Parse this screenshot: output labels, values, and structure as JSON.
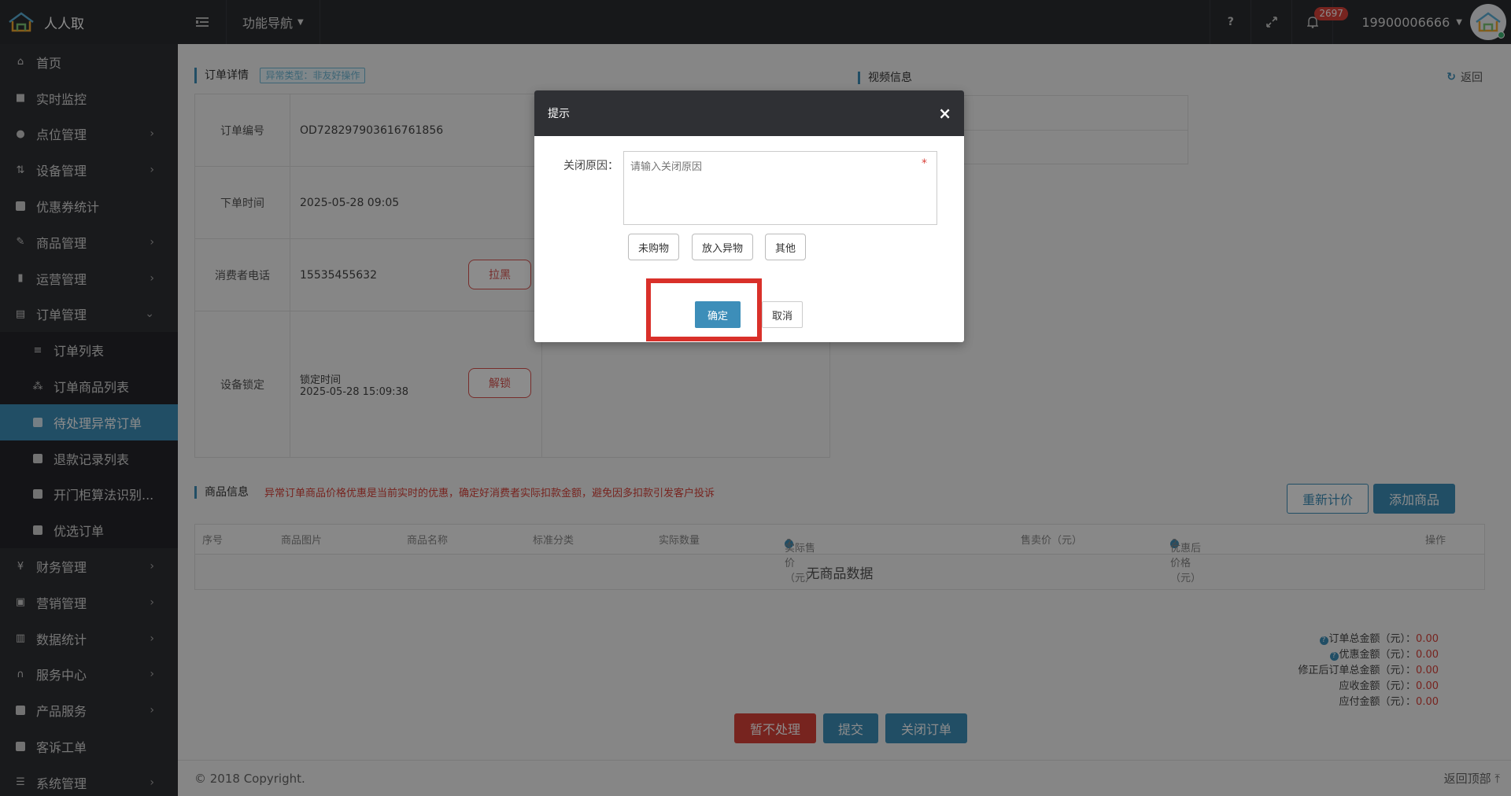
{
  "brand": {
    "name": "人人取"
  },
  "topbar": {
    "nav_label": "功能导航",
    "help": "?",
    "notification_count": "2697",
    "user_name": "19900006666"
  },
  "sidebar": {
    "items": [
      {
        "label": "首页",
        "icon": "home-icon"
      },
      {
        "label": "实时监控",
        "icon": "video-camera-icon"
      },
      {
        "label": "点位管理",
        "icon": "map-marker-icon",
        "arrow": "›"
      },
      {
        "label": "设备管理",
        "icon": "sort-icon",
        "arrow": "›"
      },
      {
        "label": "优惠券统计",
        "icon": "square-icon"
      },
      {
        "label": "商品管理",
        "icon": "edit-icon",
        "arrow": "›"
      },
      {
        "label": "运营管理",
        "icon": "bookmark-icon",
        "arrow": "›"
      },
      {
        "label": "订单管理",
        "icon": "list-alt-icon",
        "arrow": "⌄"
      }
    ],
    "sub_items": [
      {
        "label": "订单列表",
        "icon": "bars-icon"
      },
      {
        "label": "订单商品列表",
        "icon": "sitemap-icon"
      },
      {
        "label": "待处理异常订单",
        "icon": "square-icon",
        "active": true
      },
      {
        "label": "退款记录列表",
        "icon": "square-icon"
      },
      {
        "label": "开门柜算法识别...",
        "icon": "square-icon"
      },
      {
        "label": "优选订单",
        "icon": "square-icon"
      }
    ],
    "items_after": [
      {
        "label": "财务管理",
        "icon": "yen-icon",
        "arrow": "›"
      },
      {
        "label": "营销管理",
        "icon": "gift-icon",
        "arrow": "›"
      },
      {
        "label": "数据统计",
        "icon": "bar-chart-icon",
        "arrow": "›"
      },
      {
        "label": "服务中心",
        "icon": "headphones-icon",
        "arrow": "›"
      },
      {
        "label": "产品服务",
        "icon": "square-icon",
        "arrow": "›"
      },
      {
        "label": "客诉工单",
        "icon": "square-icon"
      },
      {
        "label": "系统管理",
        "icon": "list-icon",
        "arrow": "›"
      }
    ]
  },
  "order": {
    "section_title": "订单详情",
    "exception_tag": "异常类型：非友好操作",
    "order_no_label": "订单编号",
    "order_no": "OD728297903616761856",
    "order_time_label": "下单时间",
    "order_time": "2025-05-28 09:05",
    "phone_label": "消费者电话",
    "phone": "15535455632",
    "blacklist_btn": "拉黑",
    "lock_label": "设备锁定",
    "lock_time_label": "锁定时间",
    "lock_time": "2025-05-28 15:09:38",
    "unlock_btn": "解锁"
  },
  "video": {
    "section_title": "视频信息"
  },
  "return_link": "返回",
  "goods": {
    "section_title": "商品信息",
    "warning": "异常订单商品价格优惠是当前实时的优惠，确定好消费者实际扣款金额，避免因多扣款引发客户投诉",
    "recalc_btn": "重新计价",
    "add_btn": "添加商品",
    "columns": [
      "序号",
      "商品图片",
      "商品名称",
      "标准分类",
      "实际数量",
      "实际售价（元）",
      "售卖价（元）",
      "优惠后价格（元）",
      "操作"
    ],
    "empty": "无商品数据"
  },
  "totals": {
    "total_label": "订单总金额（元）：",
    "total": "0.00",
    "discount_label": "优惠金额（元）：",
    "discount": "0.00",
    "corrected_label": "修正后订单总金额（元）：",
    "corrected": "0.00",
    "receivable_label": "应收金额（元）：",
    "receivable": "0.00",
    "payable_label": "应付金额（元）：",
    "payable": "0.00"
  },
  "actions": {
    "hold": "暂不处理",
    "submit": "提交",
    "close": "关闭订单"
  },
  "footer": {
    "copyright": "© 2018 Copyright.",
    "back_top": "返回顶部 ⤒"
  },
  "modal": {
    "title": "提示",
    "close": "×",
    "reason_label": "关闭原因：",
    "reason_placeholder": "请输入关闭原因",
    "required_mark": "*",
    "quick_reasons": [
      "未购物",
      "放入异物",
      "其他"
    ],
    "confirm": "确定",
    "cancel": "取消"
  }
}
